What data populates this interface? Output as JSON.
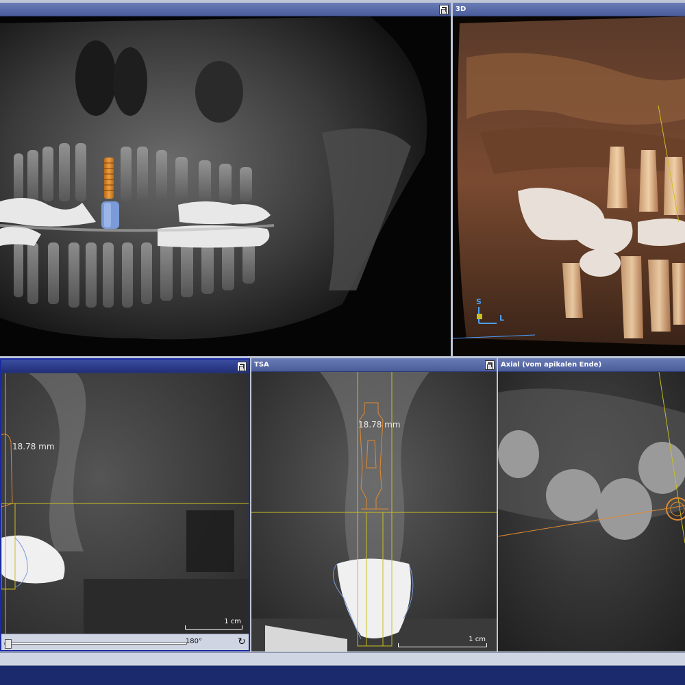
{
  "panes": {
    "panoramic": {
      "title": ""
    },
    "three_d": {
      "title": "3D",
      "orientation": {
        "superior": "S",
        "lateral": "L"
      }
    },
    "sagittal": {
      "title": "",
      "measurement": "18.78 mm",
      "scale": "1 cm",
      "slider": {
        "label": "180°",
        "value": 0.0
      }
    },
    "tsa": {
      "title": "TSA",
      "measurement": "18.78 mm",
      "scale": "1 cm"
    },
    "axial": {
      "title": "Axial (vom apikalen Ende)"
    }
  },
  "colors": {
    "title_bg": "#4a5c9a",
    "title_active": "#222f78",
    "guide_yellow": "#c8c020",
    "implant_orange": "#e08a30",
    "abutment_blue": "#7a9ad8"
  }
}
